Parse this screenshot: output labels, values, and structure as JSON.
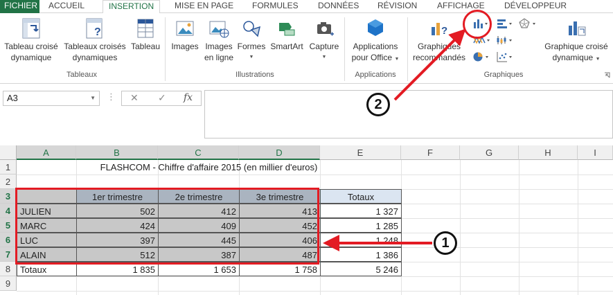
{
  "tabs": {
    "file": "FICHIER",
    "home": "ACCUEIL",
    "insert": "INSERTION",
    "layout": "MISE EN PAGE",
    "formulas": "FORMULES",
    "data": "DONNÉES",
    "review": "RÉVISION",
    "view": "AFFICHAGE",
    "developer": "DÉVELOPPEUR"
  },
  "ribbon": {
    "tableaux": {
      "group_label": "Tableaux",
      "pivot_line1": "Tableau croisé",
      "pivot_line2": "dynamique",
      "rec_pivot_line1": "Tableaux croisés",
      "rec_pivot_line2": "dynamiques",
      "table": "Tableau"
    },
    "illustrations": {
      "group_label": "Illustrations",
      "images": "Images",
      "online_line1": "Images",
      "online_line2": "en ligne",
      "shapes": "Formes",
      "smartart": "SmartArt",
      "screenshot": "Capture"
    },
    "applications": {
      "group_label": "Applications",
      "line1": "Applications",
      "line2": "pour Office"
    },
    "graphiques": {
      "group_label": "Graphiques",
      "rec_line1": "Graphiques",
      "rec_line2": "recommandés",
      "pivotchart_line1": "Graphique croisé",
      "pivotchart_line2": "dynamique"
    }
  },
  "formula_bar": {
    "name_box": "A3",
    "fx": "fx",
    "cancel": "✕",
    "enter": "✓"
  },
  "sheet": {
    "columns": [
      "A",
      "B",
      "C",
      "D",
      "E",
      "F",
      "G",
      "H",
      "I"
    ],
    "rows": [
      "1",
      "2",
      "3",
      "4",
      "5",
      "6",
      "7",
      "8",
      "9"
    ],
    "title": "FLASHCOM - Chiffre d'affaire 2015 (en millier d'euros)",
    "headers": [
      "1er trimestre",
      "2e trimestre",
      "3e trimestre"
    ],
    "totals_header": "Totaux",
    "data_rows": [
      {
        "name": "JULIEN",
        "values": [
          "502",
          "412",
          "413"
        ],
        "total": "1 327"
      },
      {
        "name": "MARC",
        "values": [
          "424",
          "409",
          "452"
        ],
        "total": "1 285"
      },
      {
        "name": "LUC",
        "values": [
          "397",
          "445",
          "406"
        ],
        "total": "1 248"
      },
      {
        "name": "ALAIN",
        "values": [
          "512",
          "387",
          "487"
        ],
        "total": "1 386"
      }
    ],
    "totals_row": {
      "label": "Totaux",
      "values": [
        "1 835",
        "1 653",
        "1 758"
      ],
      "total": "5 246"
    }
  },
  "annotations": {
    "callout_1": "1",
    "callout_2": "2",
    "color": "#e31b23"
  },
  "colors": {
    "excel_green": "#217346",
    "highlight_gray": "#c8c8c8",
    "totals_blue": "#dbe5f1"
  }
}
